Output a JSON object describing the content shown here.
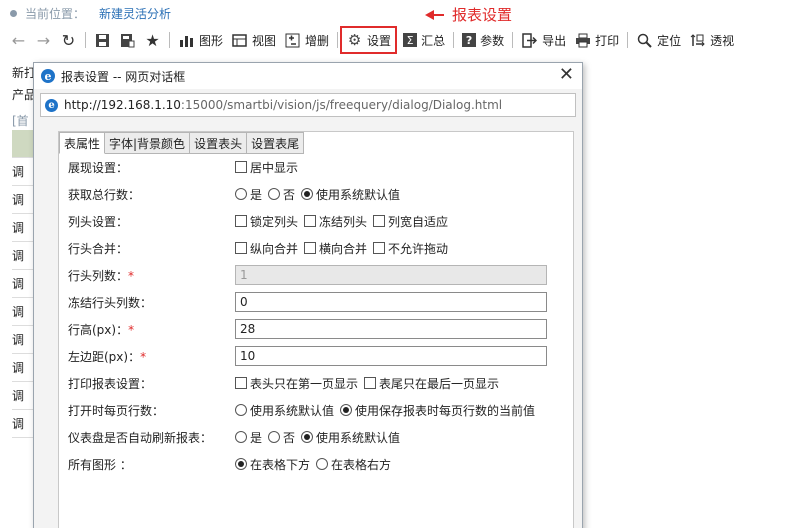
{
  "breadcrumb": {
    "label": "当前位置：",
    "current": "新建灵活分析"
  },
  "toolbar": {
    "chart": "图形",
    "view": "视图",
    "add_delete": "增删",
    "settings": "设置",
    "summary": "汇总",
    "params": "参数",
    "export": "导出",
    "print": "打印",
    "locate": "定位",
    "pivot": "透视"
  },
  "annotation": "报表设置",
  "background": {
    "line1": "新打",
    "line2": "产品",
    "link": "[首",
    "rows": [
      "调",
      "调",
      "调",
      "调",
      "调",
      "调",
      "调",
      "调",
      "调",
      "调"
    ]
  },
  "dialog": {
    "title": "报表设置 -- 网页对话框",
    "url_host": "http://192.168.1.10",
    "url_path": ":15000/smartbi/vision/js/freequery/dialog/Dialog.html",
    "tabs": [
      "表属性",
      "字体|背景颜色",
      "设置表头",
      "设置表尾"
    ],
    "form": {
      "display_label": "展现设置：",
      "display_opt": "居中显示",
      "totalrows_label": "获取总行数：",
      "totalrows_opts": [
        "是",
        "否",
        "使用系统默认值"
      ],
      "colhead_label": "列头设置：",
      "colhead_opts": [
        "锁定列头",
        "冻结列头",
        "列宽自适应"
      ],
      "rowmerge_label": "行头合并：",
      "rowmerge_opts": [
        "纵向合并",
        "横向合并",
        "不允许拖动"
      ],
      "rowheadcols_label": "行头列数：",
      "rowheadcols_value": "1",
      "freeze_label": "冻结行头列数：",
      "freeze_value": "0",
      "rowheight_label": "行高(px)：",
      "rowheight_value": "28",
      "leftmargin_label": "左边距(px)：",
      "leftmargin_value": "10",
      "print_label": "打印报表设置：",
      "print_opts": [
        "表头只在第一页显示",
        "表尾只在最后一页显示"
      ],
      "perpage_label": "打开时每页行数：",
      "perpage_opts": [
        "使用系统默认值",
        "使用保存报表时每页行数的当前值"
      ],
      "dashboard_label": "仪表盘是否自动刷新报表：",
      "dashboard_opts": [
        "是",
        "否",
        "使用系统默认值"
      ],
      "charts_label": "所有图形 ：",
      "charts_opts": [
        "在表格下方",
        "在表格右方"
      ],
      "required_mark": "*"
    }
  }
}
